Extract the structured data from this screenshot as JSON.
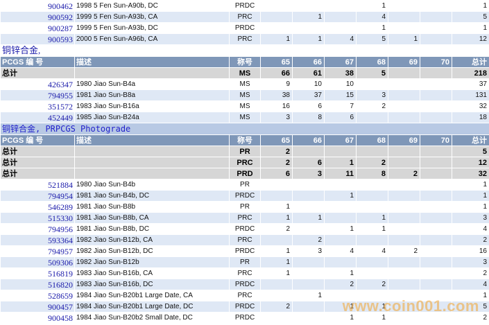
{
  "top_rows": [
    {
      "pcgs": "900462",
      "desc": "1998 5 Fen Sun-A90b, DC",
      "grade": "PRDC",
      "g65": "",
      "g66": "",
      "g67": "",
      "g68": "1",
      "g69": "",
      "g70": "",
      "total": "1"
    },
    {
      "pcgs": "900592",
      "desc": "1999 5 Fen Sun-A93b, CA",
      "grade": "PRC",
      "g65": "",
      "g66": "1",
      "g67": "",
      "g68": "4",
      "g69": "",
      "g70": "",
      "total": "5"
    },
    {
      "pcgs": "900287",
      "desc": "1999 5 Fen Sun-A93b, DC",
      "grade": "PRDC",
      "g65": "",
      "g66": "",
      "g67": "",
      "g68": "1",
      "g69": "",
      "g70": "",
      "total": "1"
    },
    {
      "pcgs": "900593",
      "desc": "2000 5 Fen Sun-A96b, CA",
      "grade": "PRC",
      "g65": "1",
      "g66": "1",
      "g67": "4",
      "g68": "5",
      "g69": "1",
      "g70": "",
      "total": "12"
    }
  ],
  "section1": {
    "title": "铜锌合金,",
    "header": {
      "pcgs": "PCGS 编 号",
      "desc": "描述",
      "grade": "称号",
      "g65": "65",
      "g66": "66",
      "g67": "67",
      "g68": "68",
      "g69": "69",
      "g70": "70",
      "total": "总计"
    },
    "totals": [
      {
        "label": "总计",
        "grade": "MS",
        "g65": "66",
        "g66": "61",
        "g67": "38",
        "g68": "5",
        "g69": "",
        "g70": "",
        "total": "218"
      }
    ],
    "rows": [
      {
        "pcgs": "426347",
        "desc": "1980 Jiao Sun-B4a",
        "grade": "MS",
        "g65": "9",
        "g66": "10",
        "g67": "10",
        "g68": "",
        "g69": "",
        "g70": "",
        "total": "37"
      },
      {
        "pcgs": "794955",
        "desc": "1981 Jiao Sun-B8a",
        "grade": "MS",
        "g65": "38",
        "g66": "37",
        "g67": "15",
        "g68": "3",
        "g69": "",
        "g70": "",
        "total": "131"
      },
      {
        "pcgs": "351572",
        "desc": "1983 Jiao Sun-B16a",
        "grade": "MS",
        "g65": "16",
        "g66": "6",
        "g67": "7",
        "g68": "2",
        "g69": "",
        "g70": "",
        "total": "32"
      },
      {
        "pcgs": "452449",
        "desc": "1985 Jiao Sun-B24a",
        "grade": "MS",
        "g65": "3",
        "g66": "8",
        "g67": "6",
        "g68": "",
        "g69": "",
        "g70": "",
        "total": "18"
      }
    ]
  },
  "section2": {
    "title": "铜锌合金, PRPCGS Photograde",
    "header": {
      "pcgs": "PCGS 编 号",
      "desc": "描述",
      "grade": "称号",
      "g65": "65",
      "g66": "66",
      "g67": "67",
      "g68": "68",
      "g69": "69",
      "g70": "70",
      "total": "总计"
    },
    "totals": [
      {
        "label": "总计",
        "grade": "PR",
        "g65": "2",
        "g66": "",
        "g67": "",
        "g68": "",
        "g69": "",
        "g70": "",
        "total": "5"
      },
      {
        "label": "总计",
        "grade": "PRC",
        "g65": "2",
        "g66": "6",
        "g67": "1",
        "g68": "2",
        "g69": "",
        "g70": "",
        "total": "12"
      },
      {
        "label": "总计",
        "grade": "PRD",
        "g65": "6",
        "g66": "3",
        "g67": "11",
        "g68": "8",
        "g69": "2",
        "g70": "",
        "total": "32"
      }
    ],
    "rows": [
      {
        "pcgs": "521884",
        "desc": "1980 Jiao Sun-B4b",
        "grade": "PR",
        "g65": "",
        "g66": "",
        "g67": "",
        "g68": "",
        "g69": "",
        "g70": "",
        "total": "1"
      },
      {
        "pcgs": "794954",
        "desc": "1981 Jiao Sun-B4b, DC",
        "grade": "PRDC",
        "g65": "",
        "g66": "",
        "g67": "1",
        "g68": "",
        "g69": "",
        "g70": "",
        "total": "1"
      },
      {
        "pcgs": "546289",
        "desc": "1981 Jiao Sun-B8b",
        "grade": "PR",
        "g65": "1",
        "g66": "",
        "g67": "",
        "g68": "",
        "g69": "",
        "g70": "",
        "total": "1"
      },
      {
        "pcgs": "515330",
        "desc": "1981 Jiao Sun-B8b, CA",
        "grade": "PRC",
        "g65": "1",
        "g66": "1",
        "g67": "",
        "g68": "1",
        "g69": "",
        "g70": "",
        "total": "3"
      },
      {
        "pcgs": "794956",
        "desc": "1981 Jiao Sun-B8b, DC",
        "grade": "PRDC",
        "g65": "2",
        "g66": "",
        "g67": "1",
        "g68": "1",
        "g69": "",
        "g70": "",
        "total": "4"
      },
      {
        "pcgs": "593364",
        "desc": "1982 Jiao Sun-B12b, CA",
        "grade": "PRC",
        "g65": "",
        "g66": "2",
        "g67": "",
        "g68": "",
        "g69": "",
        "g70": "",
        "total": "2"
      },
      {
        "pcgs": "794957",
        "desc": "1982 Jiao Sun-B12b, DC",
        "grade": "PRDC",
        "g65": "1",
        "g66": "3",
        "g67": "4",
        "g68": "4",
        "g69": "2",
        "g70": "",
        "total": "16"
      },
      {
        "pcgs": "509306",
        "desc": "1982 Jiao Sun-B12b",
        "grade": "PR",
        "g65": "1",
        "g66": "",
        "g67": "",
        "g68": "",
        "g69": "",
        "g70": "",
        "total": "3"
      },
      {
        "pcgs": "516819",
        "desc": "1983 Jiao Sun-B16b, CA",
        "grade": "PRC",
        "g65": "1",
        "g66": "",
        "g67": "1",
        "g68": "",
        "g69": "",
        "g70": "",
        "total": "2"
      },
      {
        "pcgs": "516820",
        "desc": "1983 Jiao Sun-B16b, DC",
        "grade": "PRDC",
        "g65": "",
        "g66": "",
        "g67": "2",
        "g68": "2",
        "g69": "",
        "g70": "",
        "total": "4"
      },
      {
        "pcgs": "528659",
        "desc": "1984 Jiao Sun-B20b1 Large Date, CA",
        "grade": "PRC",
        "g65": "",
        "g66": "1",
        "g67": "",
        "g68": "",
        "g69": "",
        "g70": "",
        "total": "1"
      },
      {
        "pcgs": "900457",
        "desc": "1984 Jiao Sun-B20b1 Large Date, DC",
        "grade": "PRDC",
        "g65": "2",
        "g66": "",
        "g67": "1",
        "g68": "1",
        "g69": "",
        "g70": "",
        "total": "5"
      },
      {
        "pcgs": "900458",
        "desc": "1984 Jiao Sun-B20b2 Small Date, DC",
        "grade": "PRDC",
        "g65": "",
        "g66": "",
        "g67": "1",
        "g68": "1",
        "g69": "",
        "g70": "",
        "total": "2"
      }
    ]
  },
  "watermark": "www.coin001.com"
}
